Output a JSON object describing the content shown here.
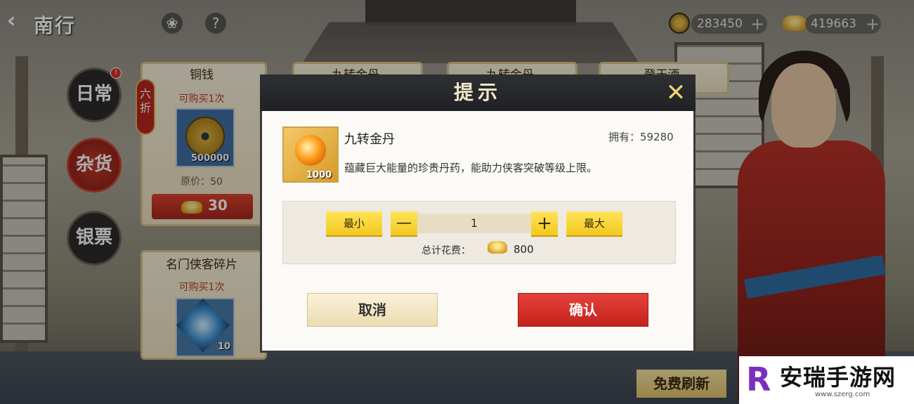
{
  "topbar": {
    "back_label": "南行",
    "icons": [
      "chest-icon",
      "help-icon"
    ],
    "help_glyph": "?",
    "currencies": [
      {
        "icon": "copper-coin-icon",
        "value": "283450"
      },
      {
        "icon": "gold-ingot-icon",
        "value": "419663"
      }
    ],
    "plus": "+"
  },
  "side_tabs": [
    {
      "label": "日常",
      "active": false,
      "badge": "!"
    },
    {
      "label": "杂货",
      "active": true
    },
    {
      "label": "银票",
      "active": false
    }
  ],
  "shop": {
    "discount_tag": "六折",
    "cards": [
      {
        "title": "铜钱",
        "limit_prefix": "可购买",
        "limit_count": "1",
        "limit_suffix": "次",
        "quantity": "500000",
        "original_price_label": "原价：50",
        "price": "30"
      },
      {
        "title": "九转金丹"
      },
      {
        "title": "九转金丹"
      },
      {
        "title": "登天酒"
      },
      {
        "title": "名门侠客碎片",
        "limit_prefix": "可购买",
        "limit_count": "1",
        "limit_suffix": "次",
        "quantity": "10"
      }
    ],
    "refresh_label": "免费刷新"
  },
  "dialog": {
    "title": "提示",
    "item": {
      "name": "九转金丹",
      "owned_label": "拥有：59280",
      "quantity_tag": "1000",
      "description": "蕴藏巨大能量的珍贵丹药，能助力侠客突破等级上限。"
    },
    "quantity": {
      "min_label": "最小",
      "minus": "—",
      "value": "1",
      "plus": "+",
      "max_label": "最大"
    },
    "total": {
      "label": "总计花费：",
      "value": "800"
    },
    "cancel_label": "取消",
    "confirm_label": "确认"
  },
  "watermark": {
    "logo": "R",
    "text": "安瑞手游网",
    "url": "www.szerg.com"
  },
  "colors": {
    "confirm_red": "#d3322a",
    "button_yellow": "#f8d63a",
    "dialog_header": "#26282c",
    "price_red": "#c0392b"
  }
}
